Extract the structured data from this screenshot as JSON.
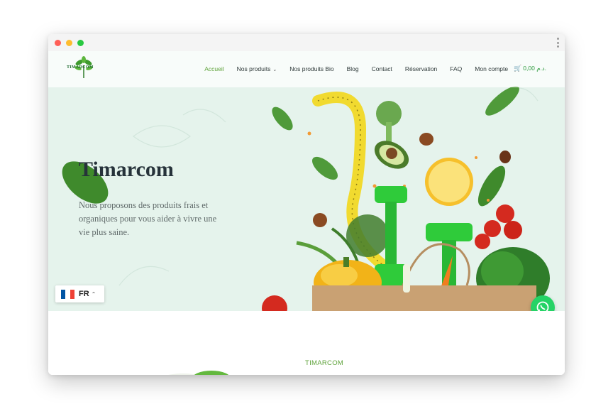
{
  "site": {
    "logo_text": "TIMARCOM"
  },
  "nav": {
    "items": [
      {
        "label": "Accueil",
        "active": true
      },
      {
        "label": "Nos produits",
        "has_dropdown": true
      },
      {
        "label": "Nos produits Bio"
      },
      {
        "label": "Blog"
      },
      {
        "label": "Contact"
      },
      {
        "label": "Réservation"
      },
      {
        "label": "FAQ"
      },
      {
        "label": "Mon compte"
      }
    ],
    "cart_label": "0,00 د.م."
  },
  "hero": {
    "title": "Timarcom",
    "subtitle": "Nous proposons des produits frais et organiques pour vous aider à vivre une vie plus saine."
  },
  "language": {
    "code": "FR",
    "flag_colors": [
      "#0055a4",
      "#ffffff",
      "#ef4135"
    ]
  },
  "section": {
    "label": "TIMARCOM"
  },
  "colors": {
    "accent": "#5fa33b",
    "hero_bg": "#e5f3ec",
    "whatsapp": "#25d366"
  },
  "icons": {
    "cart": "cart-icon",
    "whatsapp": "whatsapp-icon",
    "lang_caret": "chevron-up-icon",
    "nav_caret": "chevron-down-icon"
  }
}
